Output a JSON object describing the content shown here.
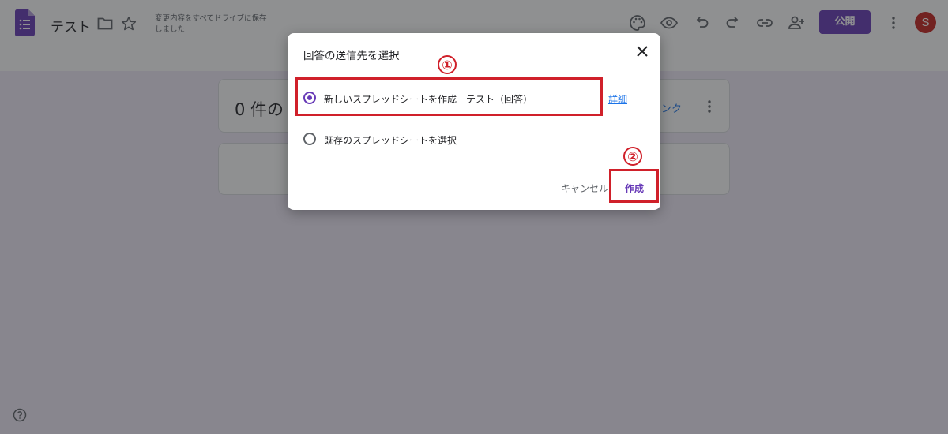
{
  "app": {
    "doc_title": "テスト",
    "save_status": "変更内容をすべてドライブに保存しました",
    "publish_label": "公開",
    "avatar_letter": "S",
    "accent_color": "#673ab7",
    "icons": [
      "forms-logo-icon",
      "folder-icon",
      "star-icon",
      "palette-icon",
      "eye-icon",
      "undo-icon",
      "redo-icon",
      "link-icon",
      "add-person-icon",
      "more-vert-icon",
      "help-icon"
    ]
  },
  "responses": {
    "count_text": "0 件の",
    "link_text": "ンク"
  },
  "dialog": {
    "title": "回答の送信先を選択",
    "options": [
      {
        "label": "新しいスプレッドシートを作成",
        "selected": true
      },
      {
        "label": "既存のスプレッドシートを選択",
        "selected": false
      }
    ],
    "sheet_name_value": "テスト（回答）",
    "details_link": "詳細",
    "cancel_label": "キャンセル",
    "create_label": "作成"
  },
  "annotations": {
    "step1": "①",
    "step2": "②",
    "color": "#d0202a"
  }
}
